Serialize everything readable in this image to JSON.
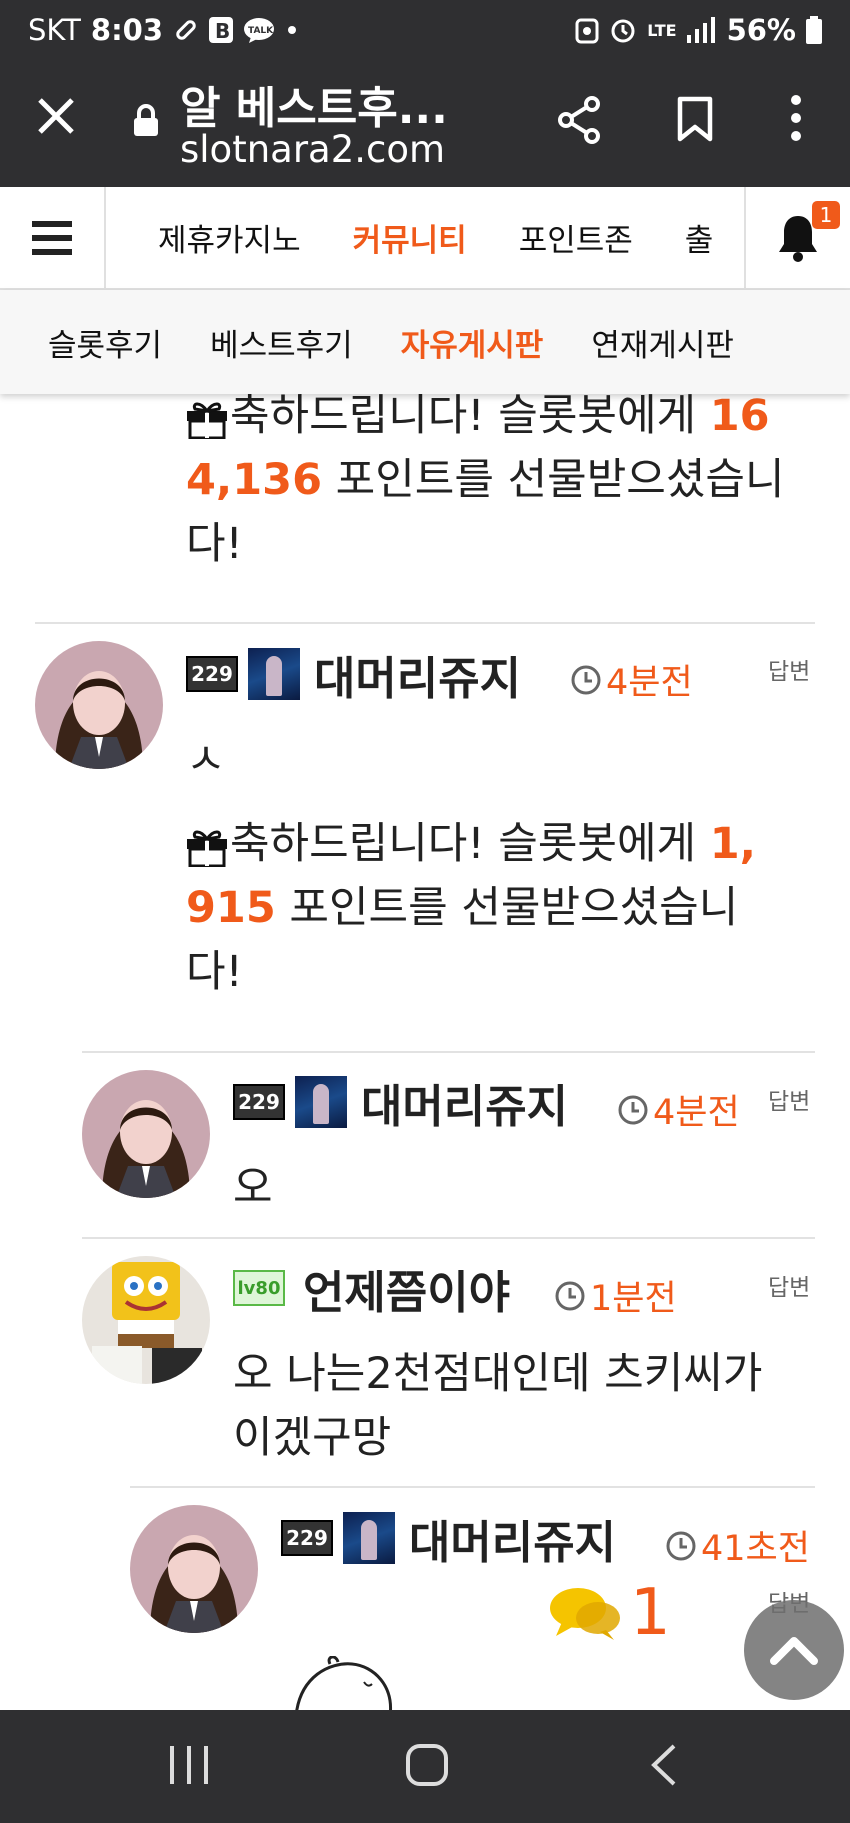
{
  "status_bar": {
    "carrier": "SKT",
    "time": "8:03",
    "network": "LTE",
    "battery": "56%"
  },
  "browser": {
    "page_title": "알 베스트후...",
    "url": "slotnara2.com"
  },
  "top_nav": {
    "tabs": [
      {
        "label": "제휴카지노",
        "active": false
      },
      {
        "label": "커뮤니티",
        "active": true
      },
      {
        "label": "포인트존",
        "active": false
      },
      {
        "label": "출",
        "active": false
      }
    ],
    "notification_count": "1"
  },
  "sub_nav": {
    "tabs": [
      {
        "label": "슬롯후기",
        "active": false
      },
      {
        "label": "베스트후기",
        "active": false
      },
      {
        "label": "자유게시판",
        "active": true
      },
      {
        "label": "연재게시판",
        "active": false
      }
    ]
  },
  "comments": [
    {
      "partial": true,
      "gift": {
        "line1_pre": "축하드립니다! 슬롯봇에게 ",
        "line1_num": "16",
        "line2_num": "4,136",
        "line2_post": " 포인트를 선물받으셨습니",
        "line3": "다!"
      }
    },
    {
      "level": "229",
      "nickname": "대머리쥬지",
      "time": "4분전",
      "reply_label": "답변",
      "text": "ㅅ",
      "gift": {
        "line1_pre": "축하드립니다! 슬롯봇에게 ",
        "line1_num": "1,",
        "line2_num": "915",
        "line2_post": " 포인트를 선물받으셨습니",
        "line3": "다!"
      }
    },
    {
      "level": "229",
      "nickname": "대머리쥬지",
      "time": "4분전",
      "reply_label": "답변",
      "text": "오"
    },
    {
      "level": "lv80",
      "nickname": "언제쯤이야",
      "time": "1분전",
      "reply_label": "답변",
      "text_line1": "오 나는2천점대인데 츠키씨가",
      "text_line2": "이겠구망"
    },
    {
      "level": "229",
      "nickname": "대머리쥬지",
      "time": "41초전",
      "reply_label": "답변",
      "comment_count": "1"
    }
  ],
  "colors": {
    "accent": "#f05a1a",
    "dark_bar": "#2f2f31",
    "speech_icon": "#f5c400"
  }
}
